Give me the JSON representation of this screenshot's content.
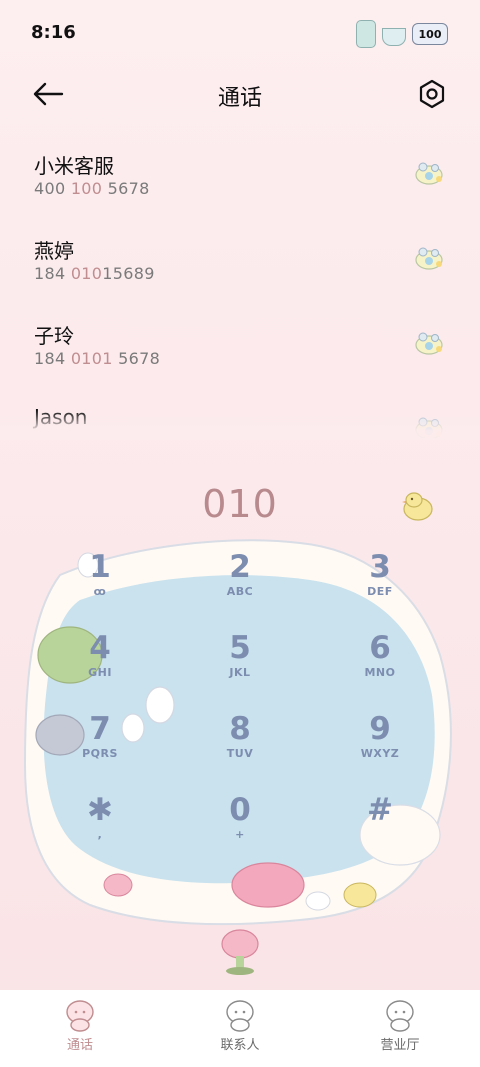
{
  "status_bar": {
    "time": "8:16",
    "battery": "100",
    "icons": [
      "bottle-icon",
      "teacup-icon",
      "battery-icon"
    ]
  },
  "header": {
    "title": "通话",
    "back_icon": "arrow-left-icon",
    "settings_icon": "settings-icon"
  },
  "contacts": [
    {
      "name": "小米客服",
      "number_parts": [
        "400 ",
        "100",
        " 5678"
      ]
    },
    {
      "name": "燕婷",
      "number_parts": [
        "184 ",
        "010",
        "15689"
      ]
    },
    {
      "name": "子玲",
      "number_parts": [
        "184 ",
        "0101",
        " 5678"
      ]
    },
    {
      "name": "Jason",
      "number_parts": [
        "",
        "",
        ""
      ]
    }
  ],
  "dialer": {
    "number": "010"
  },
  "keypad": [
    {
      "digit": "1",
      "letters": "ꝏ"
    },
    {
      "digit": "2",
      "letters": "ABC"
    },
    {
      "digit": "3",
      "letters": "DEF"
    },
    {
      "digit": "4",
      "letters": "GHI"
    },
    {
      "digit": "5",
      "letters": "JKL"
    },
    {
      "digit": "6",
      "letters": "MNO"
    },
    {
      "digit": "7",
      "letters": "PQRS"
    },
    {
      "digit": "8",
      "letters": "TUV"
    },
    {
      "digit": "9",
      "letters": "WXYZ"
    },
    {
      "digit": "✱",
      "letters": ","
    },
    {
      "digit": "0",
      "letters": "+"
    },
    {
      "digit": "#",
      "letters": ""
    }
  ],
  "bottom_nav": [
    {
      "label": "通话",
      "icon": "phone-mascot-icon",
      "active": true
    },
    {
      "label": "联系人",
      "icon": "contacts-mascot-icon",
      "active": false
    },
    {
      "label": "营业厅",
      "icon": "service-hall-mascot-icon",
      "active": false
    }
  ],
  "colors": {
    "background": "#fbe8ea",
    "pond": "#c9e2ee",
    "key_text": "#7c8db0",
    "highlight": "#c08d90"
  }
}
